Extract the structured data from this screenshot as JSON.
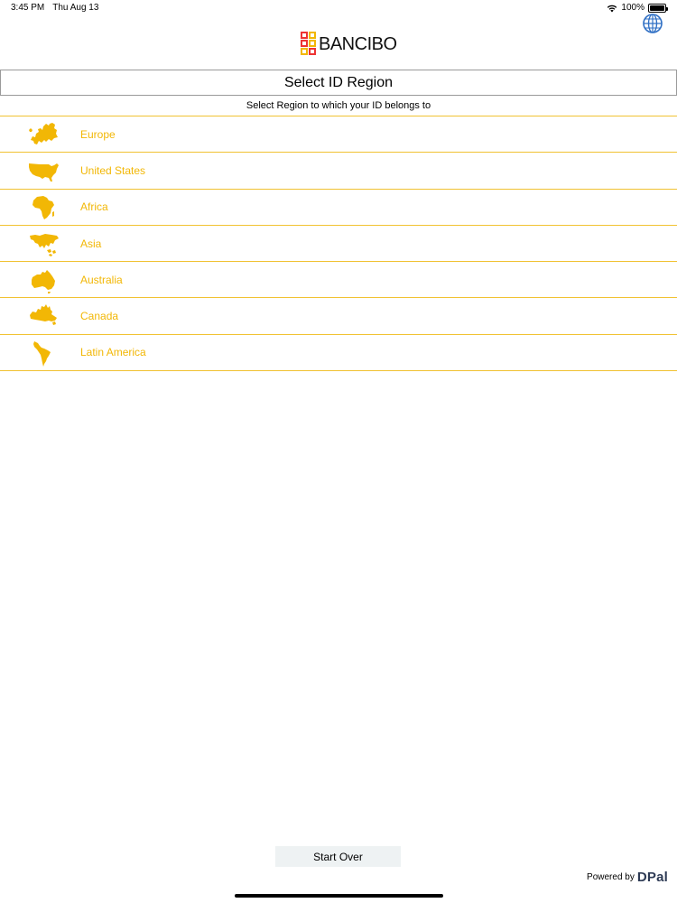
{
  "status_bar": {
    "time": "3:45 PM",
    "date": "Thu Aug 13",
    "battery_text": "100%",
    "battery_level": 1.0
  },
  "header": {
    "logo_text": "BANCIBO",
    "globe_icon": "globe-icon"
  },
  "title": "Select ID Region",
  "subtitle": "Select Region to which your ID belongs to",
  "regions": [
    {
      "label": "Europe",
      "icon": "europe-map-icon"
    },
    {
      "label": "United States",
      "icon": "usa-map-icon"
    },
    {
      "label": "Africa",
      "icon": "africa-map-icon"
    },
    {
      "label": "Asia",
      "icon": "asia-map-icon"
    },
    {
      "label": "Australia",
      "icon": "australia-map-icon"
    },
    {
      "label": "Canada",
      "icon": "canada-map-icon"
    },
    {
      "label": "Latin America",
      "icon": "latin-america-map-icon"
    }
  ],
  "footer": {
    "start_over_label": "Start Over",
    "powered_by": "Powered by",
    "powered_logo": "DPal"
  },
  "colors": {
    "accent": "#f2b705",
    "divider": "#f1c232",
    "button_bg": "#eef2f3"
  }
}
